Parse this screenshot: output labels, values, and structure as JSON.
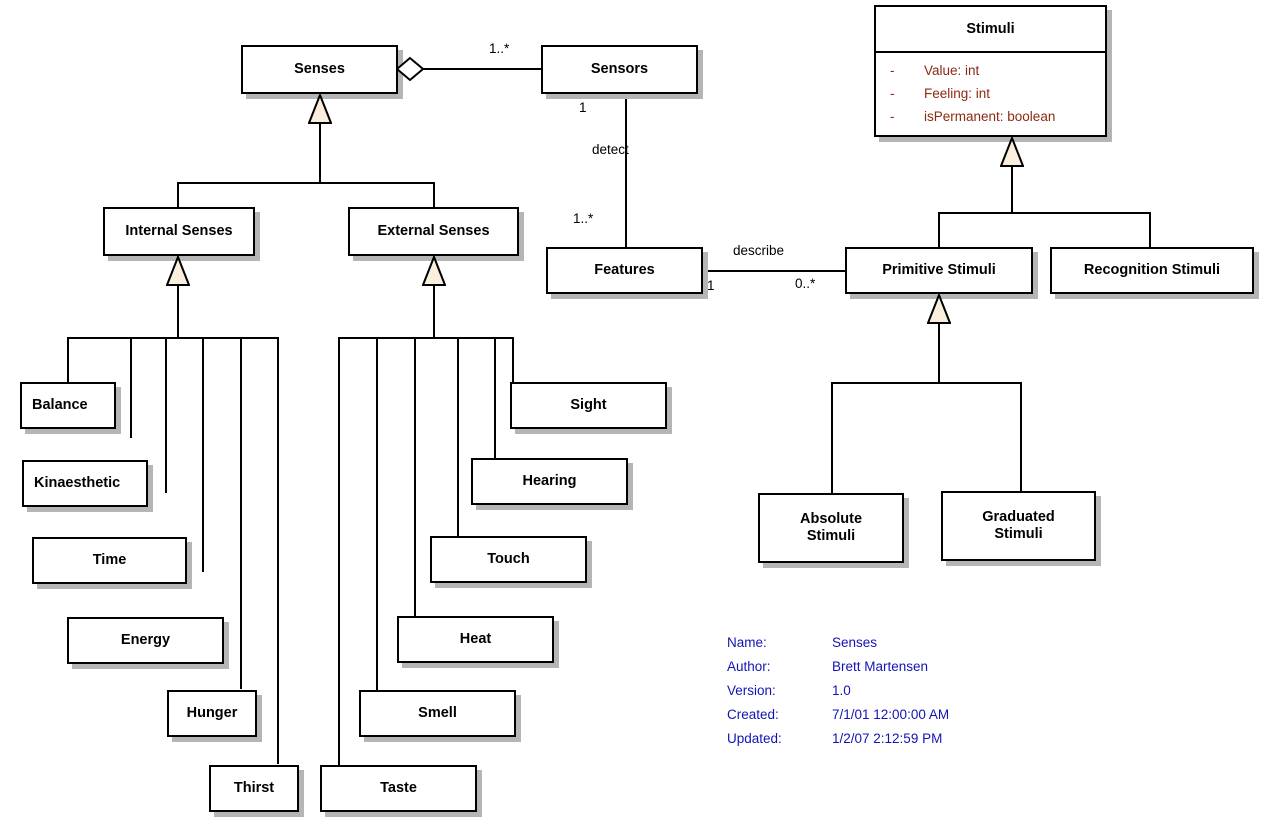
{
  "diagram": {
    "kind": "uml-class-diagram",
    "title": "Senses"
  },
  "classes": {
    "senses": {
      "name": "Senses"
    },
    "sensors": {
      "name": "Sensors"
    },
    "features": {
      "name": "Features"
    },
    "internal_senses": {
      "name": "Internal Senses"
    },
    "external_senses": {
      "name": "External Senses"
    },
    "balance": {
      "name": "Balance"
    },
    "kinaesthetic": {
      "name": "Kinaesthetic"
    },
    "time": {
      "name": "Time"
    },
    "energy": {
      "name": "Energy"
    },
    "hunger": {
      "name": "Hunger"
    },
    "thirst": {
      "name": "Thirst"
    },
    "sight": {
      "name": "Sight"
    },
    "hearing": {
      "name": "Hearing"
    },
    "touch": {
      "name": "Touch"
    },
    "heat": {
      "name": "Heat"
    },
    "smell": {
      "name": "Smell"
    },
    "taste": {
      "name": "Taste"
    },
    "stimuli": {
      "name": "Stimuli",
      "attributes": [
        {
          "visibility": "-",
          "signature": "Value:  int"
        },
        {
          "visibility": "-",
          "signature": "Feeling:  int"
        },
        {
          "visibility": "-",
          "signature": "isPermanent:  boolean"
        }
      ]
    },
    "primitive_stimuli": {
      "name": "Primitive Stimuli"
    },
    "recognition_stimuli": {
      "name": "Recognition Stimuli"
    },
    "absolute_stimuli": {
      "name": "Absolute\nStimuli"
    },
    "graduated_stimuli": {
      "name": "Graduated\nStimuli"
    }
  },
  "associations": {
    "senses_sensors": {
      "source_multiplicity": "",
      "target_multiplicity": "1..*"
    },
    "sensors_features": {
      "label": "detect",
      "source_multiplicity": "1",
      "target_multiplicity": "1..*"
    },
    "features_primitive": {
      "label": "describe",
      "source_multiplicity": "1",
      "target_multiplicity": "0..*"
    }
  },
  "metadata": {
    "rows": [
      {
        "key": "Name:",
        "value": "Senses"
      },
      {
        "key": "Author:",
        "value": "Brett Martensen"
      },
      {
        "key": "Version:",
        "value": "1.0"
      },
      {
        "key": "Created:",
        "value": "7/1/01 12:00:00 AM"
      },
      {
        "key": "Updated:",
        "value": "1/2/07 2:12:59 PM"
      }
    ]
  },
  "colors": {
    "background": "#ffffff",
    "box_border": "#000000",
    "box_fill": "#ffffff",
    "box_shadow": "#b5b5b5",
    "attribute_text": "#8b2a12",
    "metadata_text": "#1414b4",
    "generalization_fill": "#faeedc",
    "line": "#000000"
  }
}
